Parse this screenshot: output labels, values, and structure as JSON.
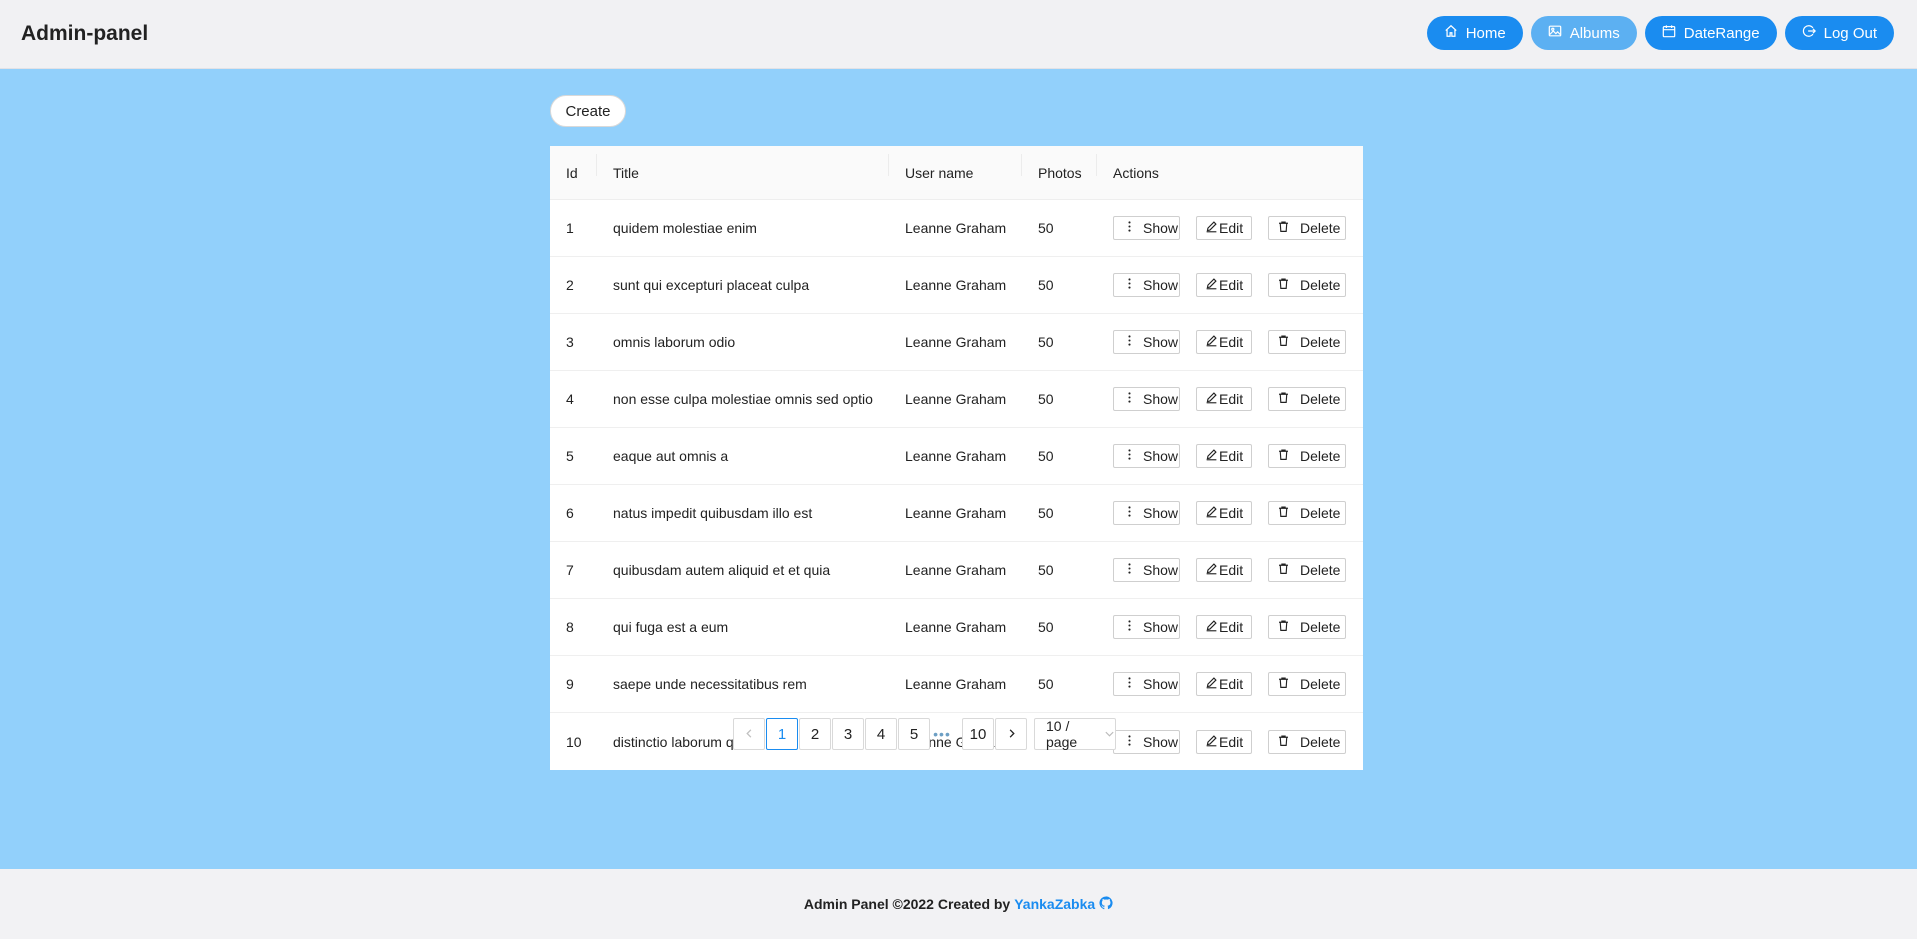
{
  "header": {
    "brand": "Admin-panel",
    "nav": [
      {
        "label": "Home",
        "icon": "home-icon",
        "active": false
      },
      {
        "label": "Albums",
        "icon": "picture-icon",
        "active": true
      },
      {
        "label": "DateRange",
        "icon": "calendar-icon",
        "active": false
      },
      {
        "label": "Log Out",
        "icon": "logout-icon",
        "active": false
      }
    ]
  },
  "toolbar": {
    "create_label": "Create"
  },
  "table": {
    "columns": [
      "Id",
      "Title",
      "User name",
      "Photos",
      "Actions"
    ],
    "actions": {
      "show": "Show",
      "edit": "Edit",
      "delete": "Delete"
    },
    "rows": [
      {
        "id": "1",
        "title": "quidem molestiae enim",
        "user": "Leanne Graham",
        "photos": "50"
      },
      {
        "id": "2",
        "title": "sunt qui excepturi placeat culpa",
        "user": "Leanne Graham",
        "photos": "50"
      },
      {
        "id": "3",
        "title": "omnis laborum odio",
        "user": "Leanne Graham",
        "photos": "50"
      },
      {
        "id": "4",
        "title": "non esse culpa molestiae omnis sed optio",
        "user": "Leanne Graham",
        "photos": "50"
      },
      {
        "id": "5",
        "title": "eaque aut omnis a",
        "user": "Leanne Graham",
        "photos": "50"
      },
      {
        "id": "6",
        "title": "natus impedit quibusdam illo est",
        "user": "Leanne Graham",
        "photos": "50"
      },
      {
        "id": "7",
        "title": "quibusdam autem aliquid et et quia",
        "user": "Leanne Graham",
        "photos": "50"
      },
      {
        "id": "8",
        "title": "qui fuga est a eum",
        "user": "Leanne Graham",
        "photos": "50"
      },
      {
        "id": "9",
        "title": "saepe unde necessitatibus rem",
        "user": "Leanne Graham",
        "photos": "50"
      },
      {
        "id": "10",
        "title": "distinctio laborum qui",
        "user": "Leanne Graham",
        "photos": "50"
      }
    ]
  },
  "pagination": {
    "pages": [
      "1",
      "2",
      "3",
      "4",
      "5"
    ],
    "last_page": "10",
    "current": "1",
    "ellipsis": "•••",
    "page_size": "10 / page"
  },
  "footer": {
    "text": "Admin Panel ©2022 Created by",
    "author": "YankaZabka"
  },
  "colors": {
    "accent": "#1a8cf0",
    "content_bg": "#92d0fb"
  }
}
